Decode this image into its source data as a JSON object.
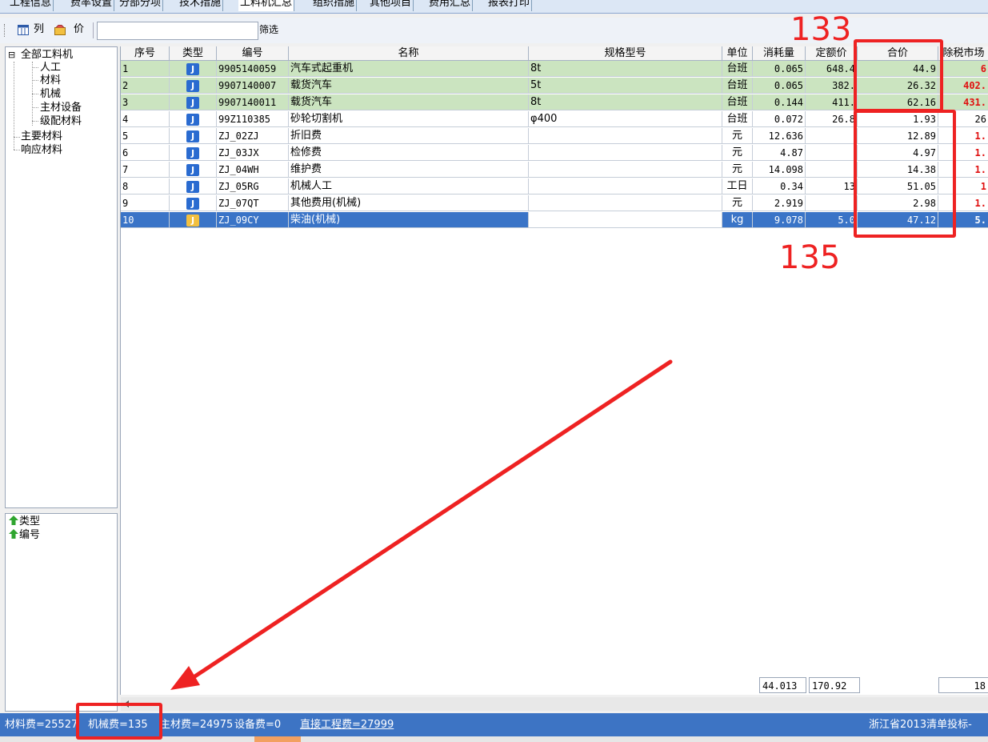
{
  "tabs": [
    {
      "label": "工程信息",
      "active": false
    },
    {
      "label": "费率设置",
      "active": false
    },
    {
      "label": "分部分项",
      "active": false
    },
    {
      "label": "技术措施",
      "active": false
    },
    {
      "label": "工料机汇总",
      "active": true
    },
    {
      "label": "组织措施",
      "active": false
    },
    {
      "label": "其他项目",
      "active": false
    },
    {
      "label": "费用汇总",
      "active": false
    },
    {
      "label": "报表打印",
      "active": false
    }
  ],
  "toolbar": {
    "columns_label": "列",
    "price_label": "价",
    "filter_value": "",
    "filter_button": "筛选"
  },
  "tree": {
    "root": "全部工料机",
    "root_toggle": "⊟",
    "children": [
      "人工",
      "材料",
      "机械",
      "主材设备",
      "级配材料"
    ],
    "others": [
      "主要材料",
      "响应材料"
    ]
  },
  "sort_panel": {
    "items": [
      "类型",
      "编号"
    ]
  },
  "grid": {
    "headers": [
      "序号",
      "类型",
      "编号",
      "名称",
      "规格型号",
      "单位",
      "消耗量",
      "定额价",
      "合价",
      "除税市场"
    ],
    "rows": [
      {
        "no": "1",
        "type": "J",
        "code": "9905140059",
        "name": "汽车式起重机",
        "spec": "8t",
        "unit": "台班",
        "qty": "0.065",
        "price": "648.4",
        "total": "44.9",
        "market": "6",
        "style": "green"
      },
      {
        "no": "2",
        "type": "J",
        "code": "9907140007",
        "name": "载货汽车",
        "spec": "5t",
        "unit": "台班",
        "qty": "0.065",
        "price": "382.",
        "total": "26.32",
        "market": "402.",
        "style": "green"
      },
      {
        "no": "3",
        "type": "J",
        "code": "9907140011",
        "name": "载货汽车",
        "spec": "8t",
        "unit": "台班",
        "qty": "0.144",
        "price": "411.",
        "total": "62.16",
        "market": "431.",
        "style": "green"
      },
      {
        "no": "4",
        "type": "J",
        "code": "99Z110385",
        "name": "砂轮切割机",
        "spec": "φ400",
        "unit": "台班",
        "qty": "0.072",
        "price": "26.8",
        "total": "1.93",
        "market": "26",
        "style": ""
      },
      {
        "no": "5",
        "type": "J",
        "code": "ZJ_02ZJ",
        "name": "折旧费",
        "spec": "",
        "unit": "元",
        "qty": "12.636",
        "price": "",
        "total": "12.89",
        "market": "1.",
        "style": ""
      },
      {
        "no": "6",
        "type": "J",
        "code": "ZJ_03JX",
        "name": "检修费",
        "spec": "",
        "unit": "元",
        "qty": "4.87",
        "price": "",
        "total": "4.97",
        "market": "1.",
        "style": ""
      },
      {
        "no": "7",
        "type": "J",
        "code": "ZJ_04WH",
        "name": "维护费",
        "spec": "",
        "unit": "元",
        "qty": "14.098",
        "price": "",
        "total": "14.38",
        "market": "1.",
        "style": ""
      },
      {
        "no": "8",
        "type": "J",
        "code": "ZJ_05RG",
        "name": "机械人工",
        "spec": "",
        "unit": "工日",
        "qty": "0.34",
        "price": "13",
        "total": "51.05",
        "market": "1",
        "style": ""
      },
      {
        "no": "9",
        "type": "J",
        "code": "ZJ_07QT",
        "name": "其他费用(机械)",
        "spec": "",
        "unit": "元",
        "qty": "2.919",
        "price": "",
        "total": "2.98",
        "market": "1.",
        "style": ""
      },
      {
        "no": "10",
        "type": "J",
        "code": "ZJ_09CY",
        "name": "柴油(机械)",
        "spec": "",
        "unit": "kg",
        "qty": "9.078",
        "price": "5.0",
        "total": "47.12",
        "market": "5.",
        "style": "sel"
      }
    ],
    "footer": {
      "qty_sum": "44.013",
      "price_sum": "170.92",
      "market_sum": "18"
    }
  },
  "status": {
    "segments": [
      "材料费=25527",
      "机械费=135",
      "主材费=24975",
      "设备费=0",
      "直接工程费=27999"
    ],
    "right": "浙江省2013清单投标-"
  },
  "annotations": {
    "label_top": "133",
    "label_mid": "135",
    "color": "#ee2222"
  },
  "colors": {
    "accent": "#3d74c4",
    "row_green": "#cbe4c0",
    "row_selected": "#3a74c7",
    "badge_blue": "#2a6bd0",
    "badge_yellow": "#f2c040",
    "red_text": "#e01010"
  }
}
